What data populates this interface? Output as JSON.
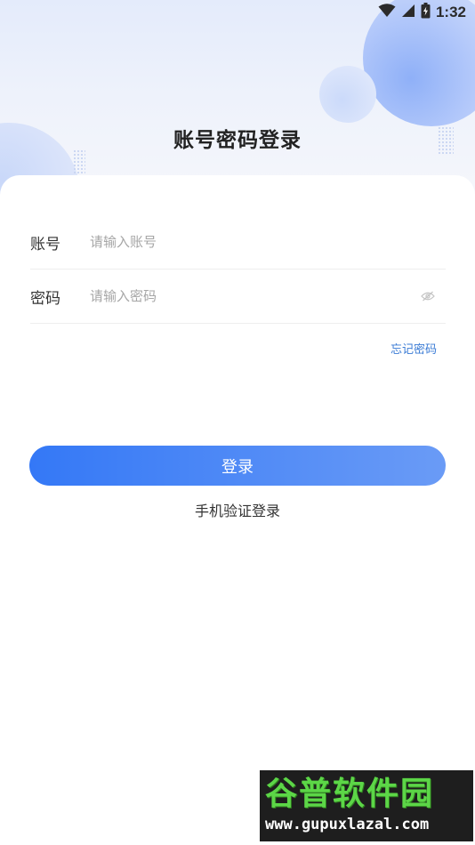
{
  "status_bar": {
    "time": "1:32",
    "icons": [
      "wifi-icon",
      "signal-icon",
      "battery-icon"
    ]
  },
  "page": {
    "title": "账号密码登录"
  },
  "form": {
    "account": {
      "label": "账号",
      "placeholder": "请输入账号",
      "value": ""
    },
    "password": {
      "label": "密码",
      "placeholder": "请输入密码",
      "value": "",
      "toggle_icon": "eye-off-icon"
    },
    "forgot_password": "忘记密码"
  },
  "actions": {
    "login_label": "登录",
    "sms_login_label": "手机验证登录"
  },
  "watermark": {
    "title": "谷普软件园",
    "url": "www.gupuxlazal.com"
  },
  "colors": {
    "primary_gradient_start": "#3478f6",
    "primary_gradient_end": "#6a9bf6",
    "link": "#3a7bd5",
    "placeholder": "#a6a6a6",
    "watermark_green": "#5cd647"
  }
}
